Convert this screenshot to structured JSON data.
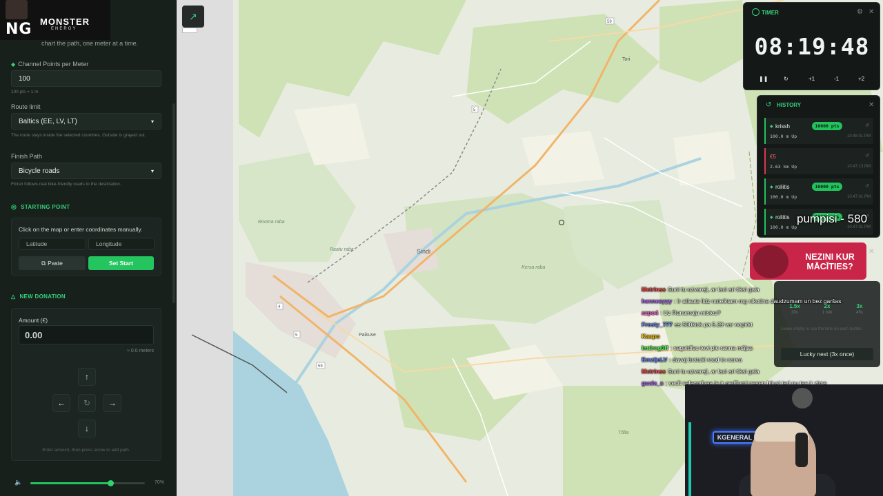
{
  "overlay": {
    "logo_ng": "NG",
    "logo_brand": "MONSTER",
    "logo_sub": "ENERGY"
  },
  "panel": {
    "hint_top": "chart the path, one meter at a time.",
    "channel_points_label": "Channel Points per Meter",
    "channel_points_value": "100",
    "channel_points_hint": "100 pts = 1 m",
    "route_limit_label": "Route limit",
    "route_limit_value": "Baltics (EE, LV, LT)",
    "route_limit_hint": "The route stays inside the selected countries. Outside is grayed out.",
    "finish_path_label": "Finish Path",
    "finish_path_value": "Bicycle roads",
    "finish_path_hint": "Finish follows real bike-friendly roads to the destination.",
    "starting_point_title": "STARTING POINT",
    "starting_point_hint": "Click on the map or enter coordinates manually.",
    "latitude_placeholder": "Latitude",
    "longitude_placeholder": "Longitude",
    "paste_label": "Paste",
    "set_start_label": "Set Start",
    "new_donation_title": "NEW DONATION",
    "amount_label": "Amount (€)",
    "amount_value": "0.00",
    "meters_readout": "≈ 0.0 meters",
    "arrow_hint": "Enter amount, then press arrow to add path.",
    "volume_percent": "70%",
    "volume_level": 0.7
  },
  "map": {
    "labels": {
      "sindi": "Sindi",
      "paikuse": "Paikuse",
      "rooma_raba": "Rooma raba",
      "raatu_raba": "Raatu raba",
      "kersa_raba": "Kersa raba",
      "tori": "Tori",
      "tolli": "Tõlla",
      "r59a": "59",
      "r59b": "59",
      "r5a": "5",
      "r5b": "5",
      "r4": "4"
    },
    "colors": {
      "forest": "#cde2b2",
      "field": "#f3f1e4",
      "water": "#aad3df",
      "road_major": "#f7c57f",
      "rail": "#8a8a8a",
      "wetland": "#d8e6cc"
    }
  },
  "timer": {
    "title": "TIMER",
    "time": "08:19:48",
    "plus1": "+1",
    "minus1": "-1",
    "plus2": "+2"
  },
  "history": {
    "title": "HISTORY",
    "items": [
      {
        "name": "krissh",
        "pts": "10000 pts",
        "sub": "100.0 m Up",
        "time": "10:48:01 PM",
        "color": "#21c45c"
      },
      {
        "name": "€5",
        "pts": "",
        "sub": "2.63 km Up",
        "time": "10:47:13 PM",
        "color": "#e0364a"
      },
      {
        "name": "roliitis",
        "pts": "10000 pts",
        "sub": "100.0 m Up",
        "time": "10:47:01 PM",
        "color": "#21c45c"
      },
      {
        "name": "roliitis",
        "pts": "10000 pts",
        "sub": "100.0 m Up",
        "time": "10:47:01 PM",
        "color": "#21c45c"
      }
    ]
  },
  "stream_overlay": {
    "pumpisi": "pumpisi - 580",
    "ad_text": "NEZINI KUR MĀCĪTIES?",
    "options": [
      {
        "x": "1.5x",
        "t": "30s"
      },
      {
        "x": "2x",
        "t": "1 min"
      },
      {
        "x": "3x",
        "t": "45s"
      }
    ],
    "options_hint": "Leave empty to use the time on each button.",
    "lucky_label": "Lucky next (3x once)",
    "cam_sign": "KGENERAL"
  },
  "chat": [
    {
      "user": "Metrinss",
      "msg": "Suni tu uzvareji, ar laci ari tiksi gala",
      "color": "#ff4d4d"
    },
    {
      "user": "hennesyyy",
      "msg": ": Ir atlauts lidz noteiktam mg nikotina daudzumam un bez garšas",
      "color": "#b36bff"
    },
    {
      "user": "azpo4",
      "msg": ": Uz Ranamaja misies?",
      "color": "#ff6ad5"
    },
    {
      "user": "Frosty_777",
      "msg": "es 500kick pa 5.29 var nopirkt",
      "color": "#6b8cff"
    },
    {
      "user": "Kaupo",
      "msg": "",
      "color": "#ffcc00"
    },
    {
      "user": "Imtireg0ff",
      "msg": ": sagaidīsu tevi pie ranna mājas",
      "color": "#5cff5c"
    },
    {
      "user": "EmzijeLV",
      "msg": ": davaj bratuki road to narva",
      "color": "#6b8cff"
    },
    {
      "user": "Metrinss",
      "msg": "Suni tu uzvareji, ar laci ari tiksi gala",
      "color": "#ff4d4d"
    },
    {
      "user": "guala_s",
      "msg": ": vecīt salacgrīvaa ja ir gadījumi nesen bijusi tad nu taa ir zime",
      "color": "#b36bff"
    }
  ]
}
